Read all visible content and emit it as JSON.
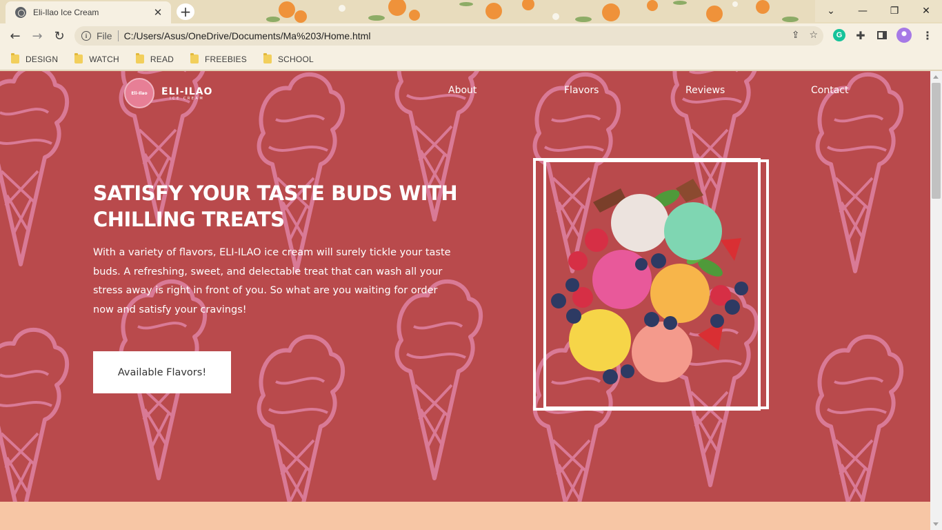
{
  "browser": {
    "tab_title": "Eli-Ilao Ice Cream",
    "tab_close": "✕",
    "new_tab": "+",
    "url_scheme": "File",
    "url": "C:/Users/Asus/OneDrive/Documents/Ma%203/Home.html",
    "bookmarks": [
      "DESIGN",
      "WATCH",
      "READ",
      "FREEBIES",
      "SCHOOL"
    ],
    "icons": [
      "back-icon",
      "forward-icon",
      "reload-icon",
      "info-icon",
      "share-icon",
      "star-icon",
      "grammarly-icon",
      "extensions-icon",
      "side-panel-icon",
      "profile-icon",
      "menu-icon",
      "folder-icon"
    ],
    "extension_letter": "G"
  },
  "site": {
    "logo_badge": "Eli-Ilao",
    "logo_name": "ELI-ILAO",
    "logo_sub": "ICE CREAM",
    "nav": [
      "About",
      "Flavors",
      "Reviews",
      "Contact"
    ],
    "hero": {
      "headline": "SATISFY YOUR TASTE BUDS WITH CHILLING TREATS",
      "body": "With a variety of flavors, ELI-ILAO ice cream will surely tickle your taste buds. A refreshing, sweet, and delectable treat that can wash all your stress away is right in front of you. So what are you waiting for order now and satisfy your cravings!",
      "cta_label": "Available Flavors!"
    }
  },
  "colors": {
    "hero_bg": "#b94a4c",
    "cone_outline": "#d97a96",
    "peach": "#f7c6a5",
    "tab_bg": "#e8dcbd"
  }
}
